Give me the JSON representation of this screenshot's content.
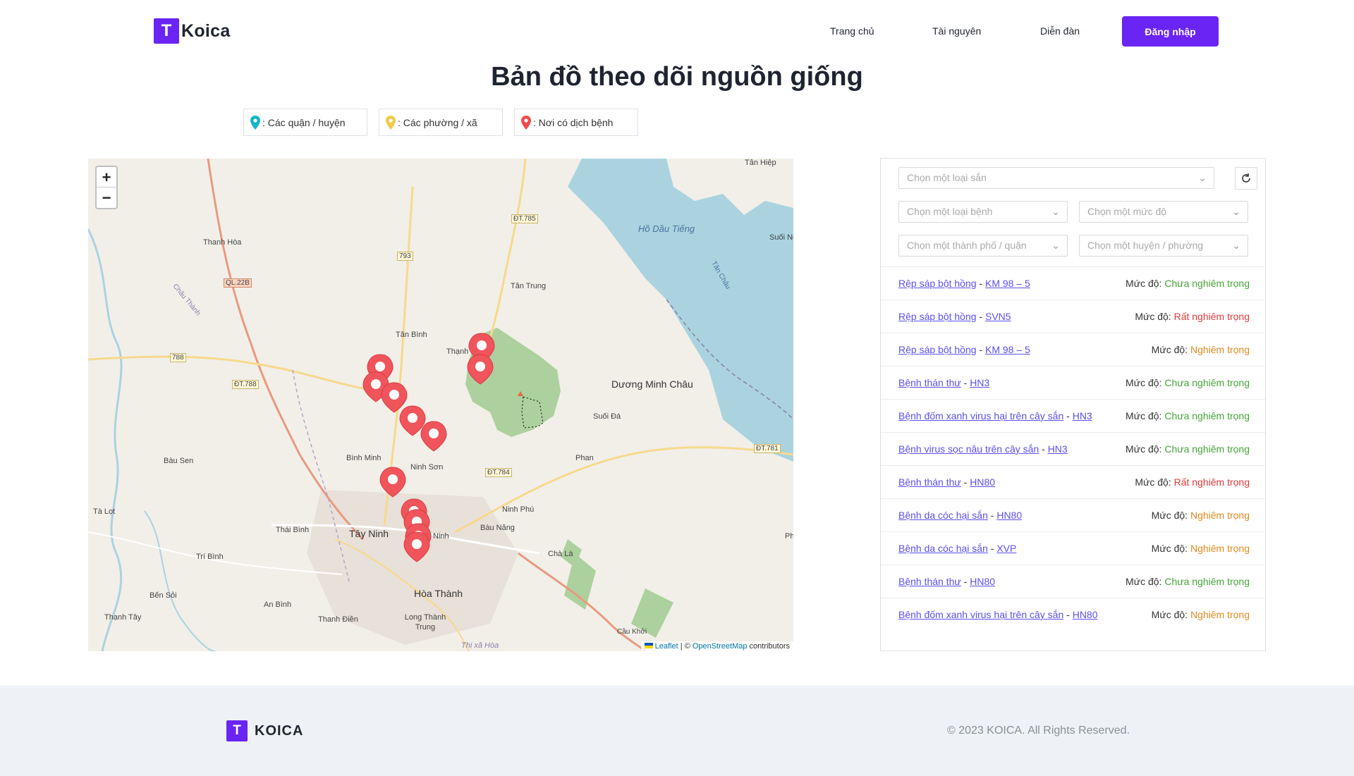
{
  "brand": {
    "logo_letter": "T",
    "name": "Koica",
    "footer_name": "KOICA"
  },
  "nav": {
    "home": "Trang chủ",
    "resources": "Tài nguyên",
    "forum": "Diễn đàn",
    "login": "Đăng nhập"
  },
  "title": "Bản đồ theo dõi nguồn giống",
  "legend": [
    {
      "label": ": Các quận / huyện",
      "color": "#12b5c9",
      "icon": "map-pin-icon"
    },
    {
      "label": ": Các phường / xã",
      "color": "#f2c94c",
      "icon": "map-pin-icon"
    },
    {
      "label": ": Nơi có dịch bệnh",
      "color": "#f24b4b",
      "icon": "map-pin-icon"
    }
  ],
  "map": {
    "zoom_in": "+",
    "zoom_out": "−",
    "attribution_prefix": "Leaflet",
    "attribution_sep": " | © ",
    "attribution_link": "OpenStreetMap",
    "attribution_suffix": " contributors",
    "labels": {
      "tan_hiep": "Tân Hiệp",
      "ho_dau_tieng": "Hồ Dầu Tiếng",
      "suoi_ng": "Suối Ng",
      "thanh_hoa": "Thanh Hòa",
      "ql22b": "QL.22B",
      "dt785": "ĐT.785",
      "dt793": "793",
      "tan_trung": "Tân Trung",
      "tan_binh": "Tân Bình",
      "thanh": "Thạnh",
      "duong_minh_chau": "Dương Minh Châu",
      "dt788": "ĐT.788",
      "r788": "788",
      "suoi_da": "Suối Đá",
      "dt781": "ĐT.781",
      "binh_minh": "Bình Minh",
      "ninh_son": "Ninh Sơn",
      "dt784": "ĐT.784",
      "phan": "Phan",
      "bau_sen": "Bàu Sen",
      "ta_lot": "Tà Lọt",
      "thai_binh": "Thái Bình",
      "tay_ninh": "Tây Ninh",
      "ninh_phu": "Ninh Phú",
      "bau_nang": "Bàu Năng",
      "tri_binh": "Trí Bình",
      "cha_la": "Chà Là",
      "ben_soi": "Bến Sỏi",
      "hoa_thanh": "Hòa Thành",
      "an_binh": "An Bình",
      "thanh_tay": "Thạnh Tây",
      "thanh_dien": "Thanh Điền",
      "long_thanh_trung": "Long Thành Trung",
      "cau_khoi": "Cầu Khởi",
      "thi_xa_hoa": "Thị xã Hòa",
      "chau_thanh": "Châu Thành",
      "tan_chau": "Tân Châu",
      "ninh_label": "Ninh",
      "ph": "Phi"
    }
  },
  "filters": {
    "land_type": "Chọn một loại sắn",
    "disease_type": "Chọn một loại bệnh",
    "severity": "Chọn một mức độ",
    "city": "Chọn một thành phố / quận",
    "district": "Chọn một huyện / phường"
  },
  "severity_colors": {
    "mild": "#46a33a",
    "severe": "#e03b3b",
    "serious": "#e08a1e"
  },
  "records": [
    {
      "disease": "Rệp sáp bột hồng",
      "variety": "KM 98 – 5",
      "severity_label": "Mức độ:",
      "severity": "Chưa nghiêm trọng",
      "level": "mild"
    },
    {
      "disease": "Rệp sáp bột hồng",
      "variety": "SVN5",
      "severity_label": "Mức độ:",
      "severity": "Rất nghiêm trọng",
      "level": "severe"
    },
    {
      "disease": "Rệp sáp bột hồng",
      "variety": "KM 98 – 5",
      "severity_label": "Mức độ:",
      "severity": "Nghiêm trọng",
      "level": "serious"
    },
    {
      "disease": "Bệnh thán thư",
      "variety": "HN3",
      "severity_label": "Mức độ:",
      "severity": "Chưa nghiêm trọng",
      "level": "mild"
    },
    {
      "disease": "Bệnh đốm xanh virus hại trên cây sắn",
      "variety": "HN3",
      "severity_label": "Mức độ:",
      "severity": "Chưa nghiêm trọng",
      "level": "mild"
    },
    {
      "disease": "Bệnh virus sọc nâu trên cây sắn",
      "variety": "HN3",
      "severity_label": "Mức độ:",
      "severity": "Chưa nghiêm trọng",
      "level": "mild"
    },
    {
      "disease": "Bệnh thán thư",
      "variety": "HN80",
      "severity_label": "Mức độ:",
      "severity": "Rất nghiêm trọng",
      "level": "severe"
    },
    {
      "disease": "Bệnh da cóc hại sắn",
      "variety": "HN80",
      "severity_label": "Mức độ:",
      "severity": "Nghiêm trọng",
      "level": "serious"
    },
    {
      "disease": "Bệnh da cóc hại sắn",
      "variety": "XVP",
      "severity_label": "Mức độ:",
      "severity": "Nghiêm trọng",
      "level": "serious"
    },
    {
      "disease": "Bệnh thán thư",
      "variety": "HN80",
      "severity_label": "Mức độ:",
      "severity": "Chưa nghiêm trọng",
      "level": "mild"
    },
    {
      "disease": "Bệnh đốm xanh virus hại trên cây sắn",
      "variety": "HN80",
      "severity_label": "Mức độ:",
      "severity": "Nghiêm trọng",
      "level": "serious"
    }
  ],
  "footer": {
    "copyright": "© 2023 KOICA. All Rights Reserved."
  }
}
